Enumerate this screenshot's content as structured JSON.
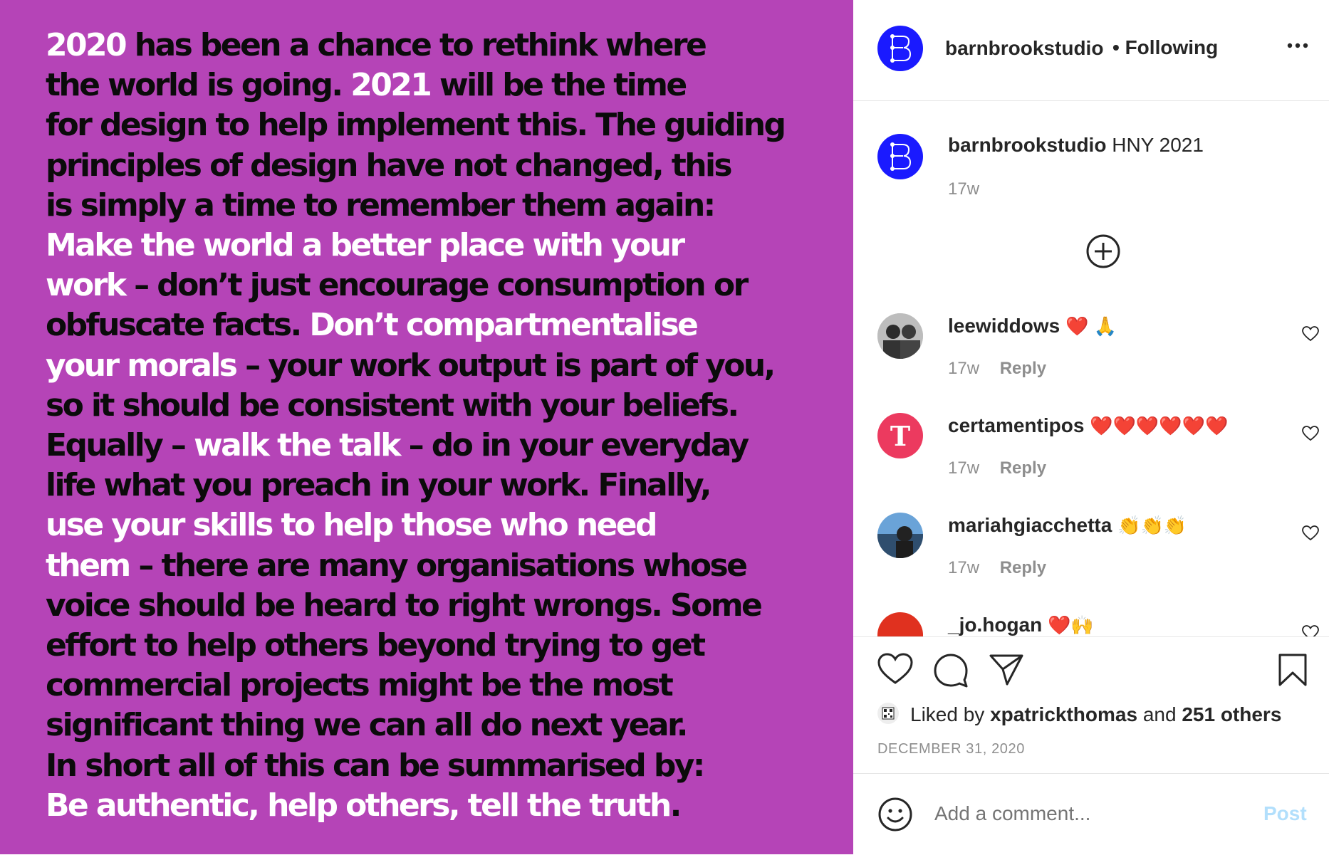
{
  "poster": {
    "l1a": "2020",
    "l1b": " has been a chance to rethink where",
    "l2a": "the world is going. ",
    "l2b": "2021",
    "l2c": " will be the time",
    "l3": "for design to help implement this. The guiding",
    "l4": "principles of design have not changed, this",
    "l5": "is simply a time to remember them again:",
    "l6": "Make the world a better place with your",
    "l7a": "work",
    "l7b": " – don’t just encourage consumption or",
    "l8a": "obfuscate facts. ",
    "l8b": "Don’t compartmentalise",
    "l9a": "your morals",
    "l9b": " – your work output is part of you,",
    "l10": "so it should be consistent with your beliefs.",
    "l11a": "Equally – ",
    "l11b": "walk the talk",
    "l11c": " – do in your everyday",
    "l12": "life what you preach in your work. Finally,",
    "l13": "use your skills to help those who need",
    "l14a": "them",
    "l14b": " – there are many organisations whose",
    "l15": "voice should be heard to right wrongs. Some",
    "l16": "effort to help others beyond trying to get",
    "l17": "commercial projects might be the most",
    "l18": "significant thing we can all do next year.",
    "l19": "In short all of this can be summarised by:",
    "l20a": "Be authentic, help others, tell the truth",
    "l20b": "."
  },
  "header": {
    "username": "barnbrookstudio",
    "follow_status": "• Following",
    "more_icon": "more-options-icon"
  },
  "caption": {
    "username": "barnbrookstudio",
    "text": "HNY 2021",
    "time": "17w"
  },
  "comments": [
    {
      "username": "leewiddows",
      "text": "❤️ 🙏",
      "time": "17w",
      "reply": "Reply"
    },
    {
      "username": "certamentipos",
      "text": "❤️❤️❤️❤️❤️❤️",
      "time": "17w",
      "reply": "Reply"
    },
    {
      "username": "mariahgiacchetta",
      "text": "👏👏👏",
      "time": "17w",
      "reply": "Reply"
    },
    {
      "username": "_jo.hogan",
      "text": "❤️🙌"
    }
  ],
  "likes": {
    "prefix": "Liked by",
    "user": "xpatrickthomas",
    "and": "and",
    "others": "251 others"
  },
  "date": "DECEMBER 31, 2020",
  "add_comment": {
    "placeholder": "Add a comment...",
    "post_label": "Post"
  },
  "colors": {
    "poster_bg": "#b544b7",
    "brand_blue": "#1a1aff",
    "post_button": "#b2dffc"
  }
}
